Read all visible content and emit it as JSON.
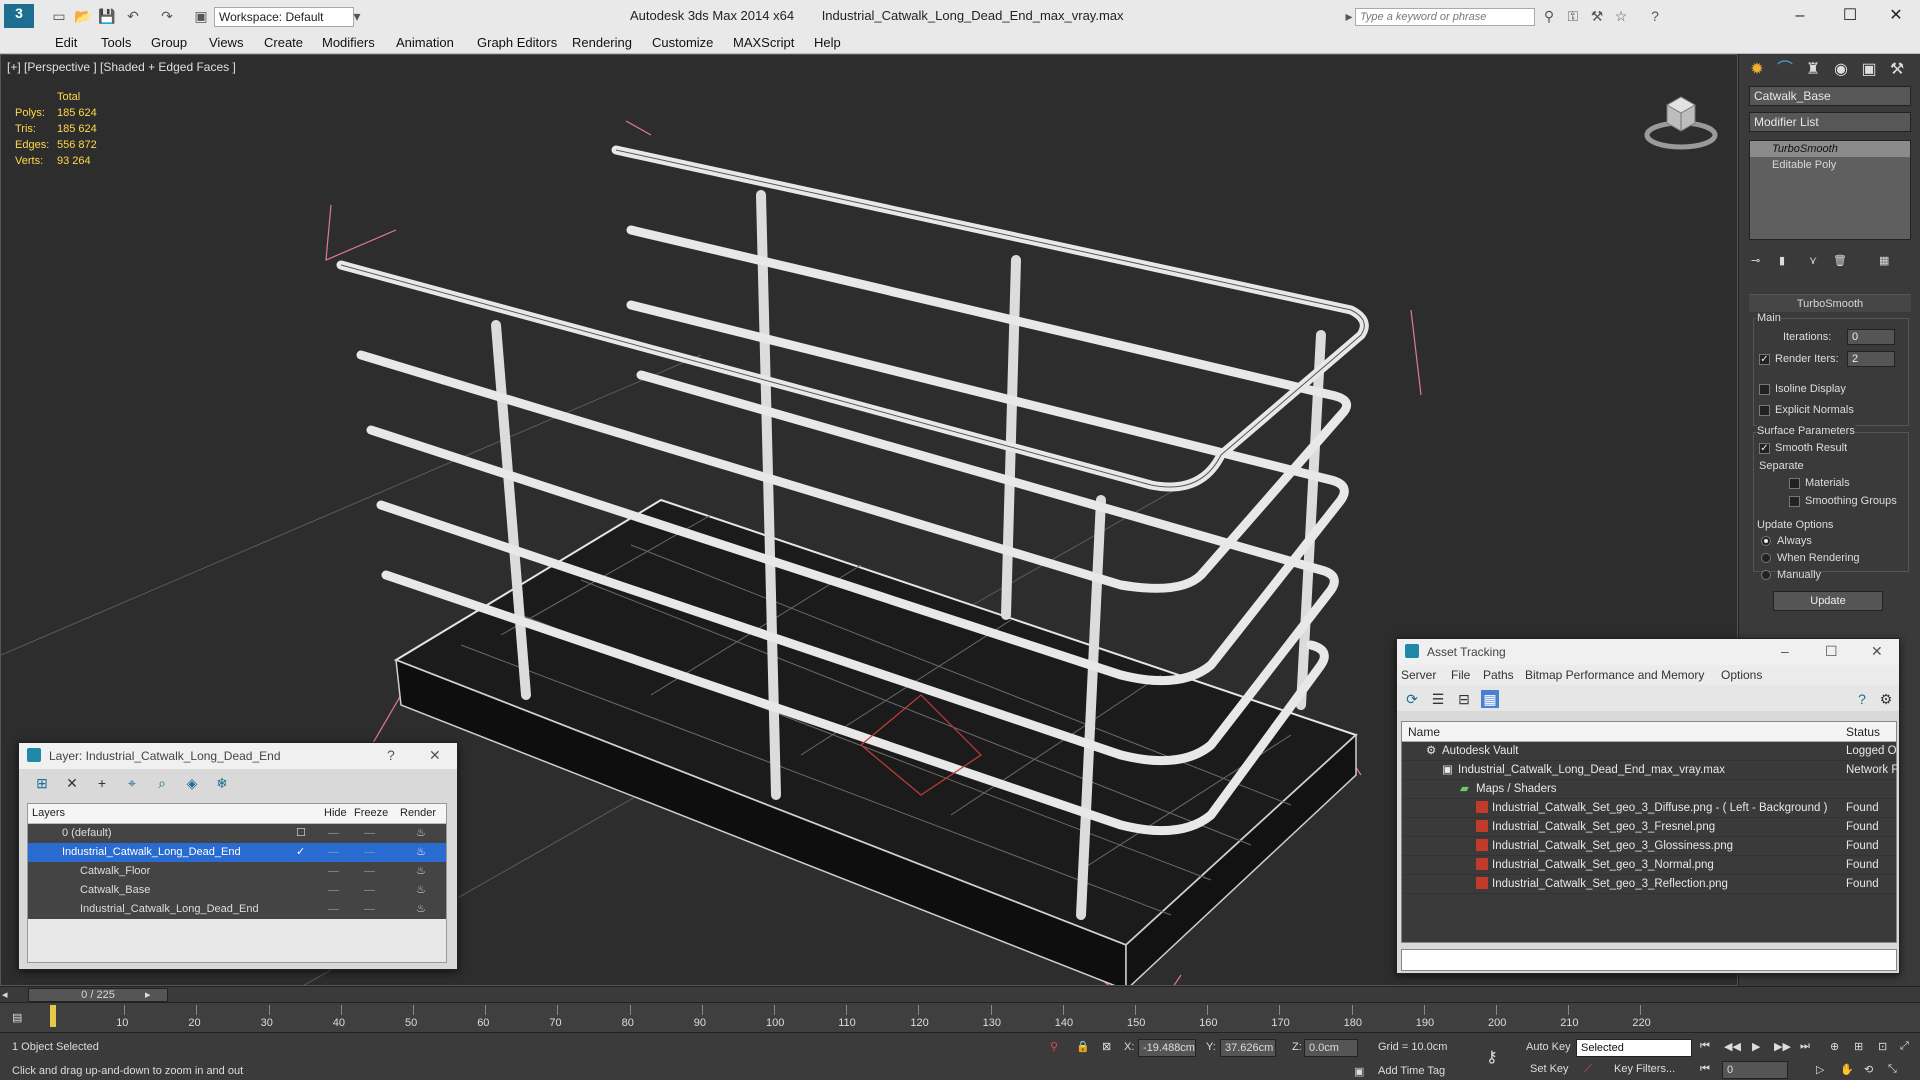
{
  "titlebar": {
    "app": "Autodesk 3ds Max  2014 x64",
    "file": "Industrial_Catwalk_Long_Dead_End_max_vray.max",
    "workspace": "Workspace: Default",
    "search_placeholder": "Type a keyword or phrase"
  },
  "menu": [
    "Edit",
    "Tools",
    "Group",
    "Views",
    "Create",
    "Modifiers",
    "Animation",
    "Graph Editors",
    "Rendering",
    "Customize",
    "MAXScript",
    "Help"
  ],
  "viewport": {
    "label": "[+] [Perspective ] [Shaded + Edged Faces ]",
    "stats": {
      "total_label": "Total",
      "rows": [
        {
          "k": "Polys:",
          "v": "185 624"
        },
        {
          "k": "Tris:",
          "v": "185 624"
        },
        {
          "k": "Edges:",
          "v": "556 872"
        },
        {
          "k": "Verts:",
          "v": "93 264"
        }
      ]
    }
  },
  "command_panel": {
    "object_name": "Catwalk_Base",
    "modifier_list": "Modifier List",
    "stack": [
      "TurboSmooth",
      "Editable Poly"
    ],
    "rollout_title": "TurboSmooth",
    "main_label": "Main",
    "iterations_label": "Iterations:",
    "iterations": "0",
    "render_iters_label": "Render Iters:",
    "render_iters": "2",
    "isoline": "Isoline Display",
    "explicit_normals": "Explicit Normals",
    "surface_params": "Surface Parameters",
    "smooth_result": "Smooth Result",
    "separate": "Separate",
    "materials": "Materials",
    "smoothing_groups": "Smoothing Groups",
    "update_options": "Update Options",
    "always": "Always",
    "when_rendering": "When Rendering",
    "manually": "Manually",
    "update_btn": "Update"
  },
  "layer_window": {
    "title": "Layer: Industrial_Catwalk_Long_Dead_End",
    "columns": {
      "layers": "Layers",
      "hide": "Hide",
      "freeze": "Freeze",
      "render": "Render"
    },
    "rows": [
      {
        "name": "0 (default)"
      },
      {
        "name": "Industrial_Catwalk_Long_Dead_End"
      },
      {
        "name": "Catwalk_Floor"
      },
      {
        "name": "Catwalk_Base"
      },
      {
        "name": "Industrial_Catwalk_Long_Dead_End"
      }
    ]
  },
  "asset_window": {
    "title": "Asset Tracking",
    "menu": [
      "Server",
      "File",
      "Paths",
      "Bitmap Performance and Memory",
      "Options"
    ],
    "columns": {
      "name": "Name",
      "status": "Status"
    },
    "rows": [
      {
        "name": "Autodesk Vault",
        "status": "Logged O"
      },
      {
        "name": "Industrial_Catwalk_Long_Dead_End_max_vray.max",
        "status": "Network F"
      },
      {
        "name": "Maps / Shaders",
        "status": ""
      },
      {
        "name": "Industrial_Catwalk_Set_geo_3_Diffuse.png - ( Left - Background )",
        "status": "Found"
      },
      {
        "name": "Industrial_Catwalk_Set_geo_3_Fresnel.png",
        "status": "Found"
      },
      {
        "name": "Industrial_Catwalk_Set_geo_3_Glossiness.png",
        "status": "Found"
      },
      {
        "name": "Industrial_Catwalk_Set_geo_3_Normal.png",
        "status": "Found"
      },
      {
        "name": "Industrial_Catwalk_Set_geo_3_Reflection.png",
        "status": "Found"
      }
    ]
  },
  "timeline": {
    "slider": "0 / 225",
    "ticks": [
      "10",
      "20",
      "30",
      "40",
      "50",
      "60",
      "70",
      "80",
      "90",
      "100",
      "110",
      "120",
      "130",
      "140",
      "150",
      "160",
      "170",
      "180",
      "190",
      "200",
      "210",
      "220"
    ]
  },
  "status": {
    "selected": "1 Object Selected",
    "hint": "Click and drag up-and-down to zoom in and out",
    "x_label": "X:",
    "x": "-19.488cm",
    "y_label": "Y:",
    "y": "37.626cm",
    "z_label": "Z:",
    "z": "0.0cm",
    "grid": "Grid = 10.0cm",
    "add_time_tag": "Add Time Tag",
    "auto_key": "Auto Key",
    "set_key": "Set Key",
    "key_mode": "Selected",
    "key_filters": "Key Filters...",
    "frame": "0"
  }
}
